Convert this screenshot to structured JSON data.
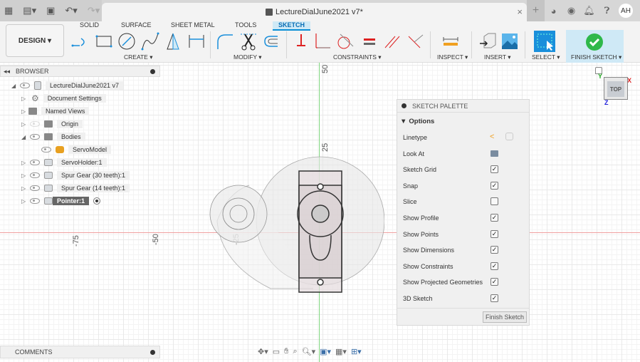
{
  "titlebar": {
    "document_title": "LectureDialJune2021 v7*",
    "close_glyph": "×",
    "new_tab_glyph": "+",
    "user_initials": "AH"
  },
  "ribbon": {
    "workspace": "DESIGN ▾",
    "tabs": [
      "SOLID",
      "SURFACE",
      "SHEET METAL",
      "TOOLS",
      "SKETCH"
    ],
    "active_tab": "SKETCH",
    "groups": {
      "create": "CREATE ▾",
      "modify": "MODIFY ▾",
      "constraints": "CONSTRAINTS ▾",
      "inspect": "INSPECT ▾",
      "insert": "INSERT ▾",
      "select": "SELECT ▾",
      "finish": "FINISH SKETCH ▾"
    },
    "accent_color": "#0a8fd6"
  },
  "browser": {
    "title": "BROWSER",
    "items": [
      {
        "label": "LectureDialJune2021 v7"
      },
      {
        "label": "Document Settings"
      },
      {
        "label": "Named Views"
      },
      {
        "label": "Origin"
      },
      {
        "label": "Bodies"
      },
      {
        "label": "ServoModel"
      },
      {
        "label": "ServoHolder:1"
      },
      {
        "label": "Spur Gear (30 teeth):1"
      },
      {
        "label": "Spur Gear (14 teeth):1"
      },
      {
        "label": "Pointer:1"
      }
    ]
  },
  "axes": {
    "y_labels": [
      "50",
      "25"
    ],
    "x_labels": [
      "-75",
      "-50",
      "-25"
    ]
  },
  "viewcube": {
    "face": "TOP"
  },
  "palette": {
    "title": "SKETCH PALETTE",
    "section": "Options",
    "rows": [
      {
        "label": "Linetype"
      },
      {
        "label": "Look At"
      },
      {
        "label": "Sketch Grid",
        "checked": true
      },
      {
        "label": "Snap",
        "checked": true
      },
      {
        "label": "Slice",
        "checked": false
      },
      {
        "label": "Show Profile",
        "checked": true
      },
      {
        "label": "Show Points",
        "checked": true
      },
      {
        "label": "Show Dimensions",
        "checked": true
      },
      {
        "label": "Show Constraints",
        "checked": true
      },
      {
        "label": "Show Projected Geometries",
        "checked": true
      },
      {
        "label": "3D Sketch",
        "checked": true
      }
    ],
    "finish_button": "Finish Sketch",
    "check_glyph": "✓"
  },
  "comments": {
    "title": "COMMENTS"
  }
}
